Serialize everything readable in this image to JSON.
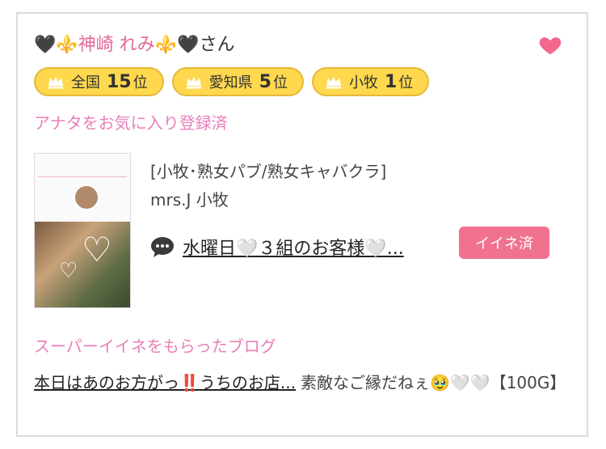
{
  "profile": {
    "name_prefix": "🖤⚜️",
    "name": "神崎 れみ",
    "name_suffix_deco": "⚜️🖤",
    "honorific": "さん",
    "favorite_icon": "heart-icon"
  },
  "ranks": [
    {
      "area": "全国",
      "rank": "15",
      "suffix": "位"
    },
    {
      "area": "愛知県",
      "rank": "5",
      "suffix": "位"
    },
    {
      "area": "小牧",
      "rank": "1",
      "suffix": "位"
    }
  ],
  "favorite_status": "アナタをお気に入り登録済",
  "shop": {
    "category": "[小牧･熟女パブ/熟女キャバクラ]",
    "name": "mrs.J 小牧"
  },
  "post": {
    "title": "水曜日🤍３組のお客様🤍...",
    "button_label": "イイネ済"
  },
  "super_iine": {
    "label": "スーパーイイネをもらったブログ",
    "blog_title_part1": "本日はあのお方がっ",
    "blog_title_emphasis": "‼️",
    "blog_title_part2": "うちのお店...",
    "comment": "素敵なご縁だねぇ🥹🤍🤍【100G】"
  },
  "colors": {
    "accent_pink": "#e87fb8",
    "button_pink": "#f0728f",
    "badge_yellow": "#ffd84d"
  }
}
